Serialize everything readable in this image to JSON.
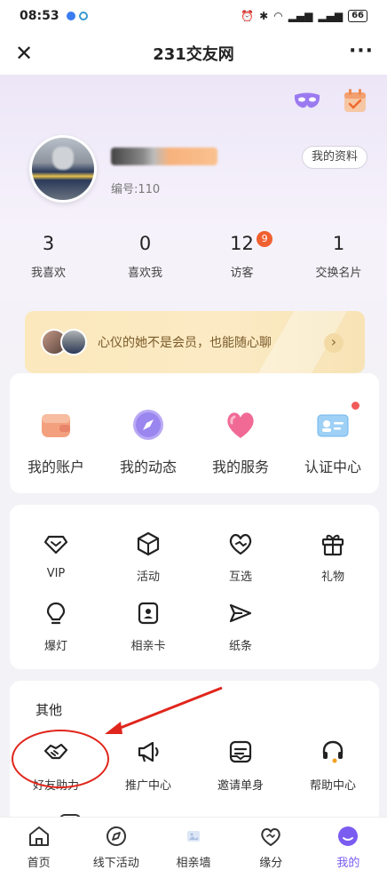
{
  "status_bar": {
    "time": "08:53",
    "battery": "66"
  },
  "title_bar": {
    "title": "231交友网"
  },
  "profile": {
    "member_id": "编号:110",
    "my_profile_button": "我的资料"
  },
  "stats": [
    {
      "value": "3",
      "label": "我喜欢"
    },
    {
      "value": "0",
      "label": "喜欢我"
    },
    {
      "value": "12",
      "label": "访客",
      "badge": "9"
    },
    {
      "value": "1",
      "label": "交换名片"
    }
  ],
  "promo": {
    "text": "心仪的她不是会员，也能随心聊"
  },
  "main_menu": [
    {
      "label": "我的账户",
      "icon": "wallet-icon"
    },
    {
      "label": "我的动态",
      "icon": "compass-icon"
    },
    {
      "label": "我的服务",
      "icon": "heart-icon"
    },
    {
      "label": "认证中心",
      "icon": "id-card-icon"
    }
  ],
  "tools": [
    {
      "label": "VIP",
      "icon": "diamond-icon"
    },
    {
      "label": "活动",
      "icon": "box-icon"
    },
    {
      "label": "互选",
      "icon": "heart-handshake-icon"
    },
    {
      "label": "礼物",
      "icon": "gift-icon"
    },
    {
      "label": "爆灯",
      "icon": "bulb-icon"
    },
    {
      "label": "相亲卡",
      "icon": "card-icon"
    },
    {
      "label": "纸条",
      "icon": "paper-plane-icon"
    }
  ],
  "other": {
    "title": "其他",
    "items": [
      {
        "label": "好友助力",
        "icon": "handshake-icon"
      },
      {
        "label": "推广中心",
        "icon": "megaphone-icon"
      },
      {
        "label": "邀请单身",
        "icon": "mail-icon"
      },
      {
        "label": "帮助中心",
        "icon": "headset-icon"
      }
    ]
  },
  "bottom_nav": [
    {
      "label": "首页",
      "icon": "home-icon"
    },
    {
      "label": "线下活动",
      "icon": "compass-icon"
    },
    {
      "label": "相亲墙",
      "icon": "photo-wall-icon"
    },
    {
      "label": "缘分",
      "icon": "heart-icon"
    },
    {
      "label": "我的",
      "icon": "profile-icon",
      "active": true
    }
  ],
  "colors": {
    "accent": "#7a5cf0",
    "badge": "#f06030",
    "annotation": "#e0261c"
  }
}
